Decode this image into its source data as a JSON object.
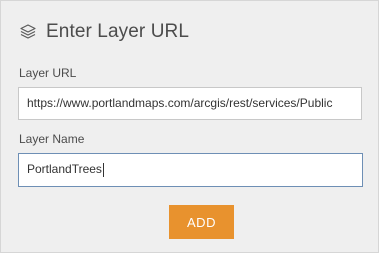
{
  "header": {
    "icon": "layers-icon",
    "title": "Enter Layer URL"
  },
  "layer_url": {
    "label": "Layer URL",
    "value": "https://www.portlandmaps.com/arcgis/rest/services/Public"
  },
  "layer_name": {
    "label": "Layer Name",
    "value": "PortlandTrees"
  },
  "actions": {
    "add_label": "ADD"
  },
  "colors": {
    "panel_bg": "#efefef",
    "accent_button": "#e8922e",
    "focus_border": "#6e8fb5",
    "text": "#4c4c4c"
  }
}
